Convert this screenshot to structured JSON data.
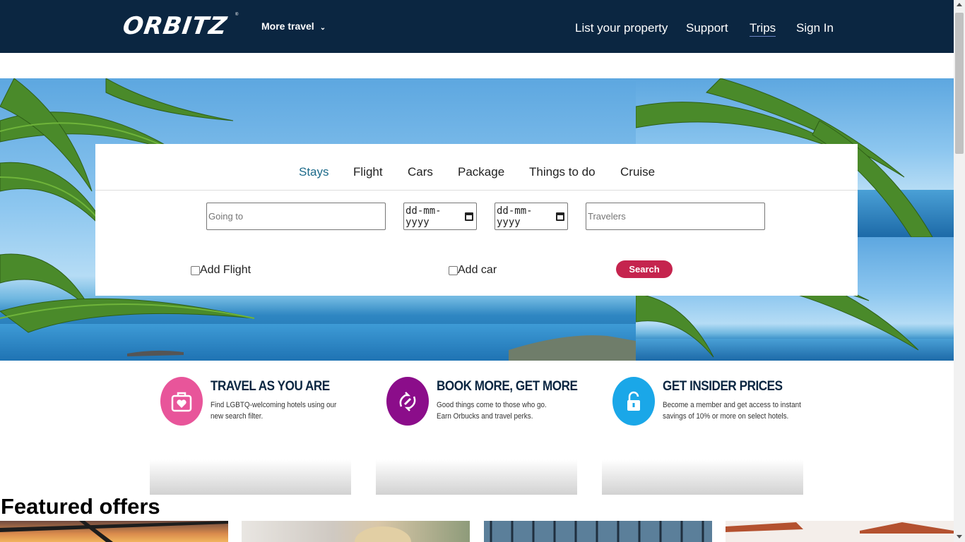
{
  "header": {
    "logo": "ORBITZ",
    "more_travel": "More travel",
    "nav": {
      "list_property": "List your property",
      "support": "Support",
      "trips": "Trips",
      "sign_in": "Sign In"
    },
    "bg_color": "#0b2641"
  },
  "search": {
    "tabs": [
      "Stays",
      "Flight",
      "Cars",
      "Package",
      "Things to do",
      "Cruise"
    ],
    "active_tab": "Stays",
    "going_to_placeholder": "Going to",
    "checkin_value": "dd-mm-yyyy",
    "checkout_value": "dd-mm-yyyy",
    "travelers_placeholder": "Travelers",
    "add_flight_label": "Add Flight",
    "add_flight_checked": false,
    "add_car_label": "Add car",
    "add_car_checked": false,
    "search_label": "Search",
    "search_color": "#c5244e"
  },
  "promos": [
    {
      "title": "TRAVEL AS YOU ARE",
      "line1": "Find LGBTQ-welcoming hotels using our",
      "line2": "new search filter.",
      "icon": "suitcase-heart-icon",
      "color": "#e8559a"
    },
    {
      "title": "BOOK MORE, GET MORE",
      "line1": "Good things come to those who go.",
      "line2": "Earn Orbucks and travel perks.",
      "icon": "orbucks-icon",
      "color": "#8b0d8a"
    },
    {
      "title": "GET INSIDER PRICES",
      "line1": "Become a member and get access to instant",
      "line2": "savings of 10% or more on select hotels.",
      "icon": "unlock-icon",
      "color": "#1aa7e8"
    }
  ],
  "featured_title": "Featured offers"
}
